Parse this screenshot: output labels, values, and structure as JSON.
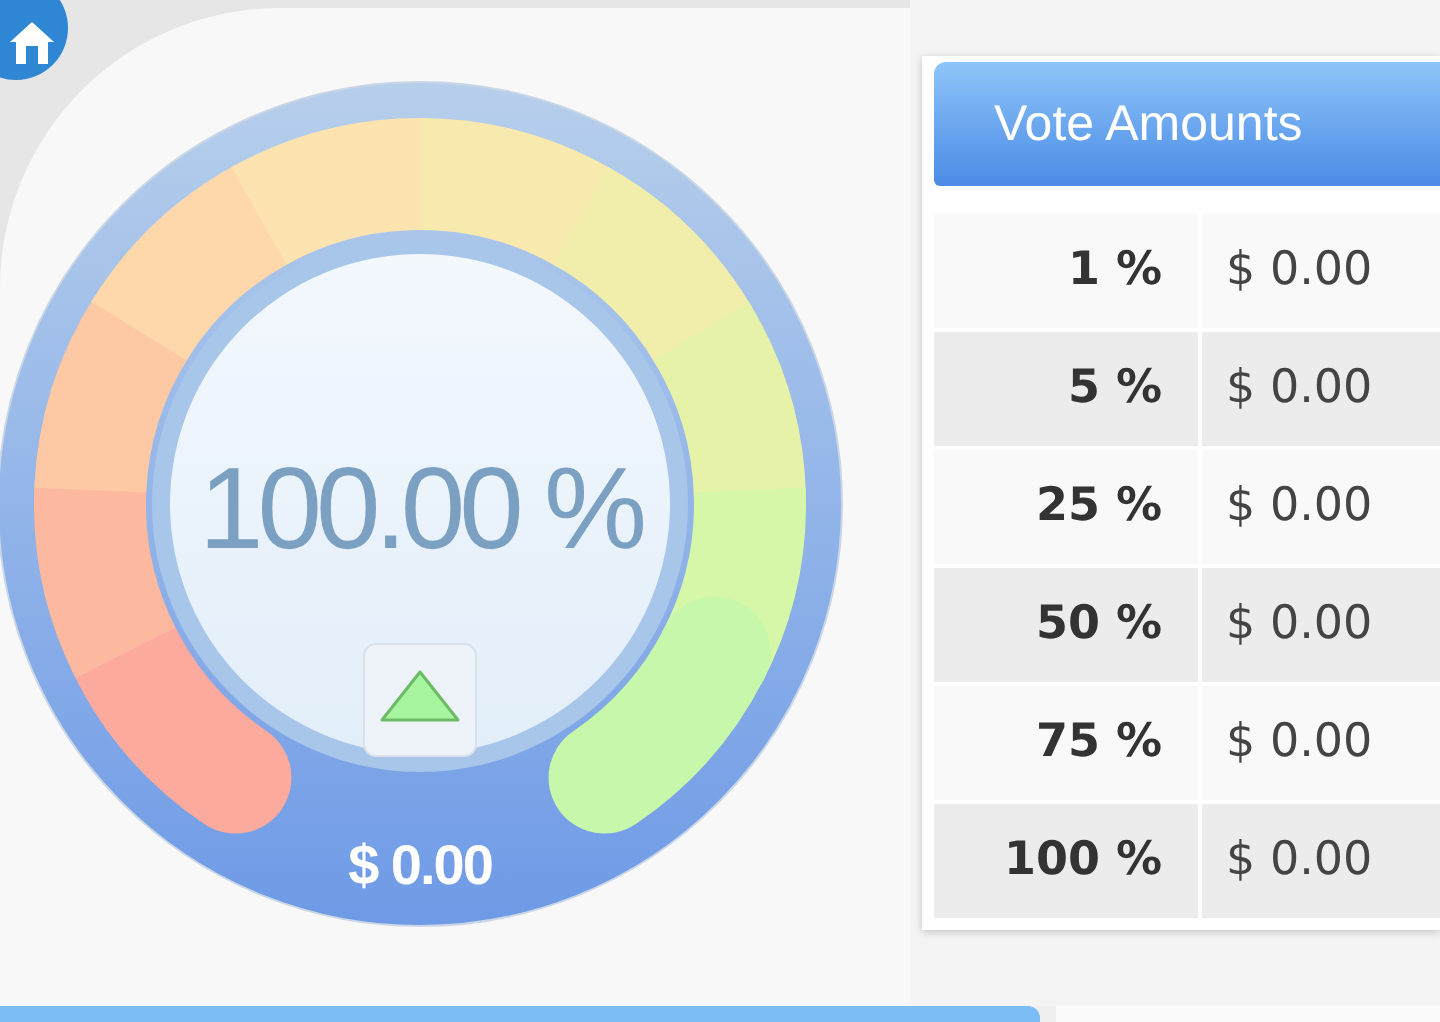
{
  "gauge": {
    "percent": "100.00 %",
    "amount": "$ 0.00"
  },
  "vote_amounts": {
    "title": "Vote Amounts",
    "rows": [
      {
        "percent": "1 %",
        "amount": "$ 0.00"
      },
      {
        "percent": "5 %",
        "amount": "$ 0.00"
      },
      {
        "percent": "25 %",
        "amount": "$ 0.00"
      },
      {
        "percent": "50 %",
        "amount": "$ 0.00"
      },
      {
        "percent": "75 %",
        "amount": "$ 0.00"
      },
      {
        "percent": "100 %",
        "amount": "$ 0.00"
      }
    ]
  }
}
